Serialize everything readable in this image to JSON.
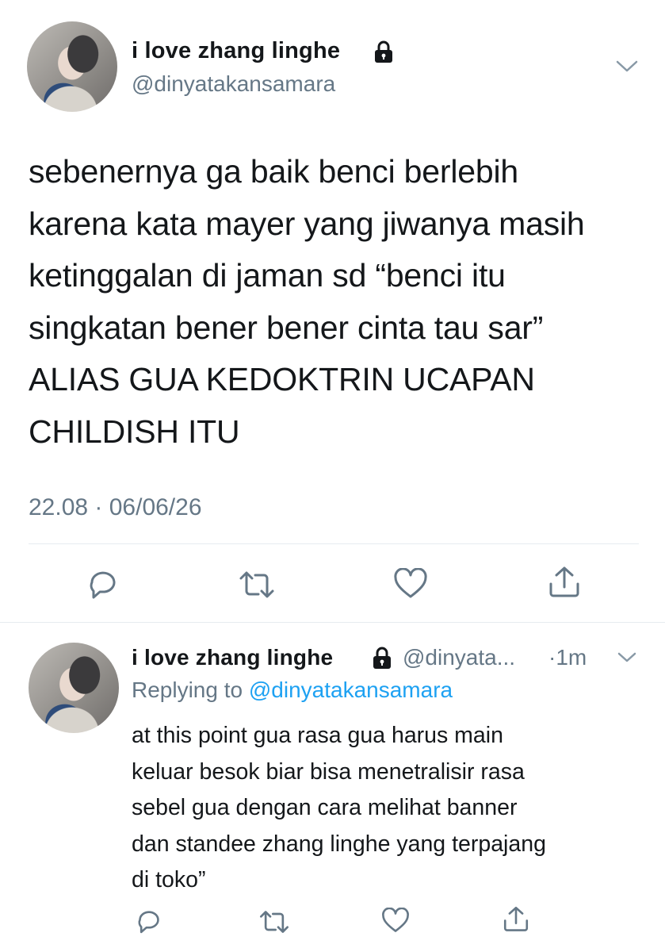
{
  "main_tweet": {
    "display_name": "i love zhang linghe",
    "handle": "@dinyatakansamara",
    "text": "sebenernya ga baik benci berlebih\nkarena kata mayer yang jiwanya masih\nketinggalan di jaman sd “benci itu\nsingkatan bener bener cinta tau sar”\nALIAS GUA KEDOKTRIN UCAPAN\nCHILDISH ITU",
    "timestamp": "22.08 · 06/06/26"
  },
  "reply_tweet": {
    "display_name": "i love zhang linghe",
    "handle": "@dinyata...",
    "age": "·1m",
    "replying_prefix": "Replying to",
    "replying_to": "@dinyatakansamara",
    "text": "at this point gua rasa gua harus main\nkeluar besok biar bisa menetralisir rasa\nsebel gua dengan cara melihat banner\ndan standee zhang linghe yang terpajang\ndi toko”"
  },
  "icons": {
    "lock": "lock-icon",
    "chevron": "chevron-down-icon",
    "reply": "reply-icon",
    "retweet": "retweet-icon",
    "like": "heart-icon",
    "share": "share-icon"
  },
  "colors": {
    "text": "#14171a",
    "muted": "#657786",
    "link": "#1da1f2",
    "divider": "#e6ecf0"
  }
}
